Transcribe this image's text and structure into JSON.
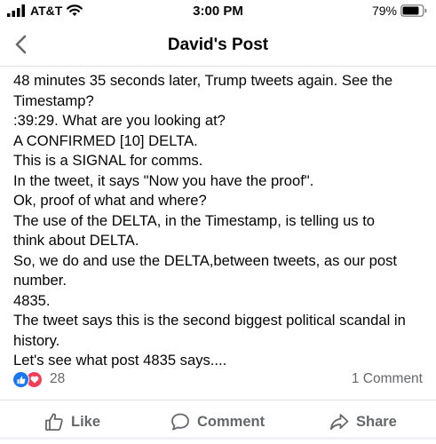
{
  "status_bar": {
    "carrier": "AT&T",
    "time": "3:00 PM",
    "battery_percent": "79%",
    "icons": [
      "signal-icon",
      "wifi-icon",
      "battery-icon"
    ]
  },
  "nav": {
    "title": "David's Post",
    "back_icon": "chevron-left-icon"
  },
  "post": {
    "lines": [
      "48 minutes 35 seconds later, Trump tweets again. See the",
      "Timestamp?",
      ":39:29. What are you looking at?",
      "A CONFIRMED [10] DELTA.",
      "This is a SIGNAL for comms.",
      "In the tweet, it says \"Now you have the proof\".",
      "Ok, proof of what and where?",
      "The use of the DELTA, in the Timestamp, is telling us to",
      "think about DELTA.",
      "So, we do and use the DELTA,between tweets, as our post",
      "number.",
      "4835.",
      "The tweet says this is the second biggest political scandal in",
      "history.",
      "Let's see what post 4835 says...."
    ]
  },
  "reactions": {
    "count": "28",
    "comments": "1 Comment",
    "types": [
      "like-reaction-icon",
      "love-reaction-icon"
    ],
    "like_color": "#1877f2",
    "love_color": "#f33e58"
  },
  "actions": {
    "like": "Like",
    "comment": "Comment",
    "share": "Share"
  },
  "colors": {
    "text": "#050505",
    "secondary": "#65676b",
    "accent_blue": "#1877f2",
    "nav_chevron": "#65676b"
  }
}
